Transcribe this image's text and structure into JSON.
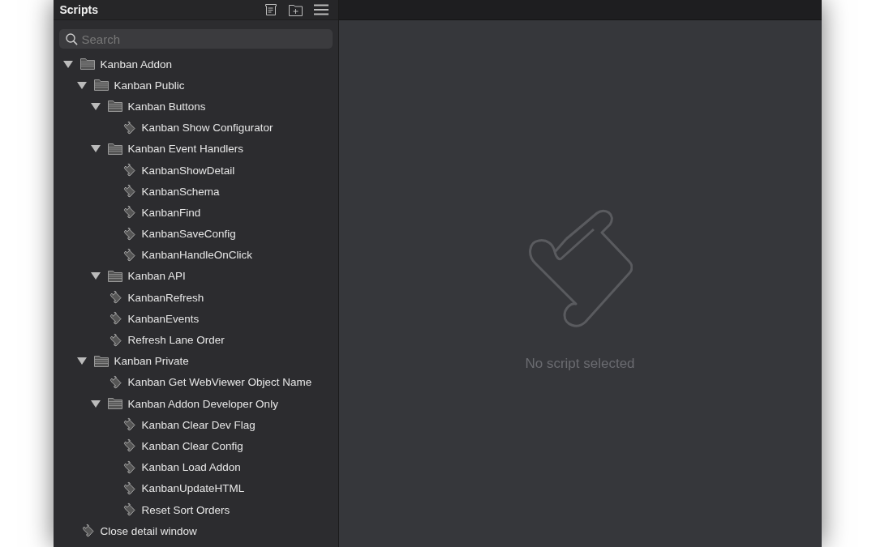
{
  "sidebar": {
    "title": "Scripts",
    "search": {
      "placeholder": "Search"
    },
    "tree": [
      {
        "kind": "folder",
        "label": "Kanban Addon",
        "expanded": true,
        "children": [
          {
            "kind": "folder",
            "label": "Kanban Public",
            "expanded": true,
            "children": [
              {
                "kind": "folder",
                "label": "Kanban Buttons",
                "expanded": true,
                "children": [
                  {
                    "kind": "script",
                    "label": "Kanban Show Configurator"
                  }
                ]
              },
              {
                "kind": "folder",
                "label": "Kanban Event Handlers",
                "expanded": true,
                "children": [
                  {
                    "kind": "script",
                    "label": "KanbanShowDetail"
                  },
                  {
                    "kind": "script",
                    "label": "KanbanSchema"
                  },
                  {
                    "kind": "script",
                    "label": "KanbanFind"
                  },
                  {
                    "kind": "script",
                    "label": "KanbanSaveConfig"
                  },
                  {
                    "kind": "script",
                    "label": "KanbanHandleOnClick"
                  }
                ]
              },
              {
                "kind": "folder",
                "label": "Kanban API",
                "expanded": true
              },
              {
                "kind": "script",
                "label": "KanbanRefresh"
              },
              {
                "kind": "script",
                "label": "KanbanEvents"
              },
              {
                "kind": "script",
                "label": "Refresh Lane Order"
              }
            ]
          },
          {
            "kind": "folder",
            "label": "Kanban Private",
            "expanded": true,
            "children": [
              {
                "kind": "script",
                "label": "Kanban Get WebViewer Object Name"
              },
              {
                "kind": "folder",
                "label": "Kanban Addon Developer Only",
                "expanded": true,
                "children": [
                  {
                    "kind": "script",
                    "label": "Kanban Clear Dev Flag"
                  },
                  {
                    "kind": "script",
                    "label": "Kanban Clear Config"
                  },
                  {
                    "kind": "script",
                    "label": "Kanban Load Addon"
                  },
                  {
                    "kind": "script",
                    "label": "KanbanUpdateHTML"
                  },
                  {
                    "kind": "script",
                    "label": "Reset Sort Orders"
                  }
                ]
              }
            ]
          }
        ]
      },
      {
        "kind": "script",
        "label": "Close detail window"
      }
    ]
  },
  "main": {
    "empty_message": "No script selected"
  }
}
